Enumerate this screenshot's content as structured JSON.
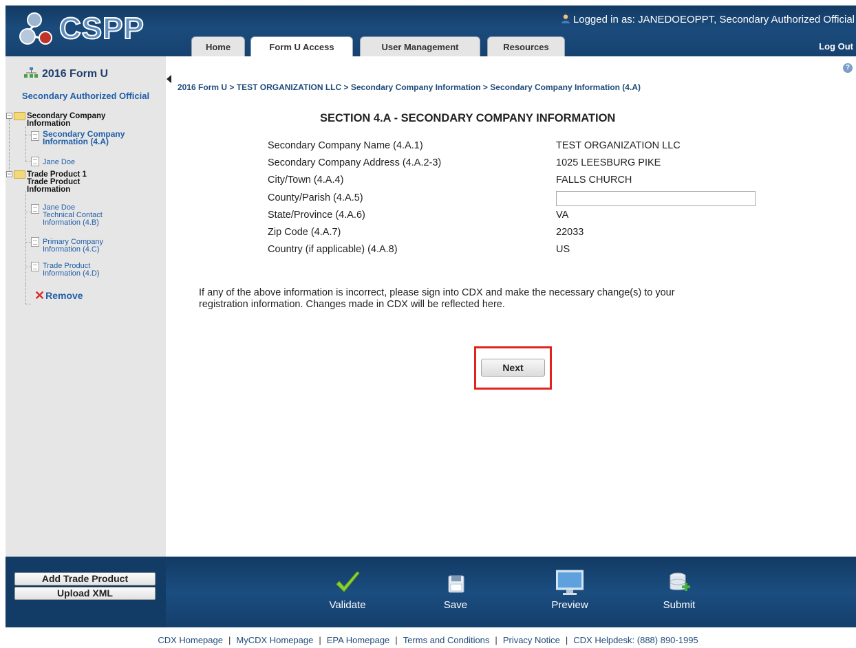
{
  "header": {
    "logo_text": "CSPP",
    "login_info": "Logged in as: JANEDOEOPPT, Secondary Authorized Official",
    "logout_label": "Log Out",
    "tabs": [
      {
        "label": "Home"
      },
      {
        "label": "Form U Access"
      },
      {
        "label": "User Management"
      },
      {
        "label": "Resources"
      }
    ],
    "active_tab": "Form U Access"
  },
  "sidebar": {
    "title": "2016 Form U",
    "role": "Secondary Authorized Official",
    "tree": {
      "secondary_company": {
        "folder_label_1": "Secondary Company",
        "folder_label_2": "Information",
        "child_1_line_1": "Secondary Company",
        "child_1_line_2": "Information (4.A)",
        "child_2": "Jane Doe"
      },
      "trade_product": {
        "folder_label_1": "Trade Product 1",
        "folder_label_2": "Trade Product",
        "folder_label_3": "Information",
        "child_1_line_1": "Jane Doe",
        "child_1_line_2": "Technical Contact",
        "child_1_line_3": "Information (4.B)",
        "child_2_line_1": "Primary Company",
        "child_2_line_2": "Information (4.C)",
        "child_3_line_1": "Trade Product",
        "child_3_line_2": "Information (4.D)"
      }
    },
    "remove_label": "Remove"
  },
  "breadcrumb": {
    "items": [
      "2016 Form U",
      "TEST ORGANIZATION LLC",
      "Secondary Company Information",
      "Secondary Company Information (4.A)"
    ],
    "separator": ">"
  },
  "section": {
    "title": "SECTION 4.A - SECONDARY COMPANY INFORMATION",
    "fields": [
      {
        "label": "Secondary Company Name (4.A.1)",
        "value": "TEST ORGANIZATION LLC"
      },
      {
        "label": "Secondary Company Address (4.A.2-3)",
        "value": "1025 LEESBURG PIKE"
      },
      {
        "label": "City/Town (4.A.4)",
        "value": "FALLS CHURCH"
      },
      {
        "label": "County/Parish (4.A.5)",
        "value": ""
      },
      {
        "label": "State/Province (4.A.6)",
        "value": "VA"
      },
      {
        "label": "Zip Code (4.A.7)",
        "value": "22033"
      },
      {
        "label": "Country (if applicable) (4.A.8)",
        "value": "US"
      }
    ],
    "note_line_1": "If any of the above information is incorrect, please sign into CDX and make the necessary change(s) to your",
    "note_line_2": "registration information. Changes made in CDX will be reflected here.",
    "next_label": "Next",
    "highlight_color": "#e0231d"
  },
  "bottom": {
    "left_buttons": [
      {
        "label": "Add Trade Product"
      },
      {
        "label": "Upload XML"
      }
    ],
    "actions": [
      {
        "label": "Validate",
        "icon": "checkmark-icon"
      },
      {
        "label": "Save",
        "icon": "floppy-disk-icon"
      },
      {
        "label": "Preview",
        "icon": "monitor-icon"
      },
      {
        "label": "Submit",
        "icon": "database-add-icon"
      }
    ]
  },
  "footer": {
    "links": [
      "CDX Homepage",
      "MyCDX Homepage",
      "EPA Homepage",
      "Terms and Conditions",
      "Privacy Notice",
      "CDX Helpdesk: (888) 890-1995"
    ],
    "separator": "|"
  },
  "colors": {
    "header_blue": "#1b4b7c",
    "link_blue": "#1f5ea8",
    "sidebar_gray": "#e6e6e6"
  }
}
